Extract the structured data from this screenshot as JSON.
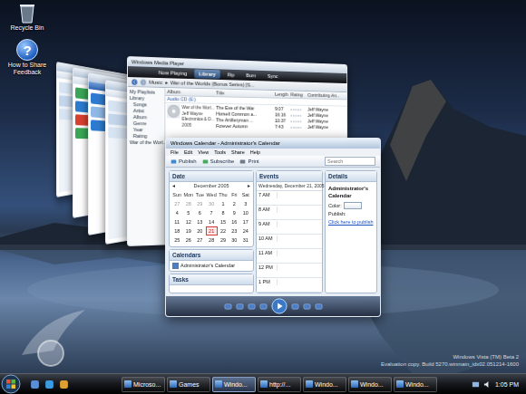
{
  "desktop_icons": [
    {
      "label": "Recycle Bin",
      "kind": "bin",
      "glyph": ""
    },
    {
      "label": "How to Share Feedback",
      "kind": "help",
      "glyph": "?"
    }
  ],
  "back_windows": [
    {
      "kind": "explorer"
    },
    {
      "kind": "gallery"
    },
    {
      "kind": "browser"
    },
    {
      "kind": "explorer"
    }
  ],
  "media_player": {
    "title": "Windows Media Player",
    "tabs": [
      {
        "label": "Now Playing",
        "selected": false
      },
      {
        "label": "Library",
        "selected": true
      },
      {
        "label": "Rip",
        "selected": false
      },
      {
        "label": "Burn",
        "selected": false
      },
      {
        "label": "Sync",
        "selected": false
      }
    ],
    "breadcrumb": [
      "Music",
      "War of the Worlds (Bonus Series) [S..."
    ],
    "separator": "▸",
    "nav": [
      "My Playlists",
      "Library",
      "Songs",
      "Artist",
      "Album",
      "Genre",
      "Year",
      "Rating",
      "War of the Worl..."
    ],
    "columns": [
      "Album",
      "Title",
      "Length",
      "Rating",
      "Contributing Art..."
    ],
    "album": {
      "group": "Audio CD (E:)",
      "lines": [
        "War of the Worl...",
        "Jeff Wayne",
        "Electronica & D...",
        "2005"
      ]
    },
    "tracks": [
      {
        "title": "The Eve of the War",
        "length": "9:07",
        "artist": "Jeff Wayne"
      },
      {
        "title": "Horsell Common a...",
        "length": "16:16",
        "artist": "Jeff Wayne"
      },
      {
        "title": "The Artilleryman ...",
        "length": "10:37",
        "artist": "Jeff Wayne"
      },
      {
        "title": "Forever Autumn",
        "length": "7:43",
        "artist": "Jeff Wayne"
      }
    ]
  },
  "calendar": {
    "title": "Windows Calendar - Administrator's Calendar",
    "menu": [
      "File",
      "Edit",
      "View",
      "Tools",
      "Share",
      "Help"
    ],
    "toolbar": [
      "Publish",
      "Subscribe",
      "Print"
    ],
    "search": {
      "placeholder": "Search"
    },
    "date_panel": {
      "title": "Date",
      "month": "December 2005",
      "prev": "◂",
      "next": "▸",
      "weekdays": [
        "Sun",
        "Mon",
        "Tue",
        "Wed",
        "Thu",
        "Fri",
        "Sat"
      ],
      "days": [
        {
          "d": "27",
          "outside": true,
          "selected": false
        },
        {
          "d": "28",
          "outside": true,
          "selected": false
        },
        {
          "d": "29",
          "outside": true,
          "selected": false
        },
        {
          "d": "30",
          "outside": true,
          "selected": false
        },
        {
          "d": "1",
          "outside": false,
          "selected": false
        },
        {
          "d": "2",
          "outside": false,
          "selected": false
        },
        {
          "d": "3",
          "outside": false,
          "selected": false
        },
        {
          "d": "4",
          "outside": false,
          "selected": false
        },
        {
          "d": "5",
          "outside": false,
          "selected": false
        },
        {
          "d": "6",
          "outside": false,
          "selected": false
        },
        {
          "d": "7",
          "outside": false,
          "selected": false
        },
        {
          "d": "8",
          "outside": false,
          "selected": false
        },
        {
          "d": "9",
          "outside": false,
          "selected": false
        },
        {
          "d": "10",
          "outside": false,
          "selected": false
        },
        {
          "d": "11",
          "outside": false,
          "selected": false
        },
        {
          "d": "12",
          "outside": false,
          "selected": false
        },
        {
          "d": "13",
          "outside": false,
          "selected": false
        },
        {
          "d": "14",
          "outside": false,
          "selected": false
        },
        {
          "d": "15",
          "outside": false,
          "selected": false
        },
        {
          "d": "16",
          "outside": false,
          "selected": false
        },
        {
          "d": "17",
          "outside": false,
          "selected": false
        },
        {
          "d": "18",
          "outside": false,
          "selected": false
        },
        {
          "d": "19",
          "outside": false,
          "selected": false
        },
        {
          "d": "20",
          "outside": false,
          "selected": false
        },
        {
          "d": "21",
          "outside": false,
          "selected": true
        },
        {
          "d": "22",
          "outside": false,
          "selected": false
        },
        {
          "d": "23",
          "outside": false,
          "selected": false
        },
        {
          "d": "24",
          "outside": false,
          "selected": false
        },
        {
          "d": "25",
          "outside": false,
          "selected": false
        },
        {
          "d": "26",
          "outside": false,
          "selected": false
        },
        {
          "d": "27",
          "outside": false,
          "selected": false
        },
        {
          "d": "28",
          "outside": false,
          "selected": false
        },
        {
          "d": "29",
          "outside": false,
          "selected": false
        },
        {
          "d": "30",
          "outside": false,
          "selected": false
        },
        {
          "d": "31",
          "outside": false,
          "selected": false
        }
      ]
    },
    "calendars": {
      "title": "Calendars",
      "items": [
        {
          "label": "Administrator's Calendar",
          "checked": true
        }
      ]
    },
    "tasks": {
      "title": "Tasks"
    },
    "events": {
      "title": "Events",
      "date": "Wednesday, December 21, 2005",
      "hours": [
        "7 AM",
        "8 AM",
        "9 AM",
        "10 AM",
        "11 AM",
        "12 PM",
        "1 PM"
      ]
    },
    "details": {
      "title": "Details",
      "name": "Administrator's Calendar",
      "color_label": "Color:",
      "publish_label": "Publish:",
      "publish_link": "Click here to publish"
    }
  },
  "watermark": [
    "Windows Vista (TM) Beta 2",
    "Evaluation copy. Build 5270.winmain_idx02.051214-1600"
  ],
  "taskbar": {
    "buttons": [
      {
        "label": "Microso...",
        "selected": false
      },
      {
        "label": "Games",
        "selected": false
      },
      {
        "label": "Windo...",
        "selected": true
      },
      {
        "label": "http://...",
        "selected": false
      },
      {
        "label": "Windo...",
        "selected": false
      },
      {
        "label": "Windo...",
        "selected": false
      },
      {
        "label": "Windo...",
        "selected": false
      }
    ],
    "clock": "1:05 PM"
  }
}
